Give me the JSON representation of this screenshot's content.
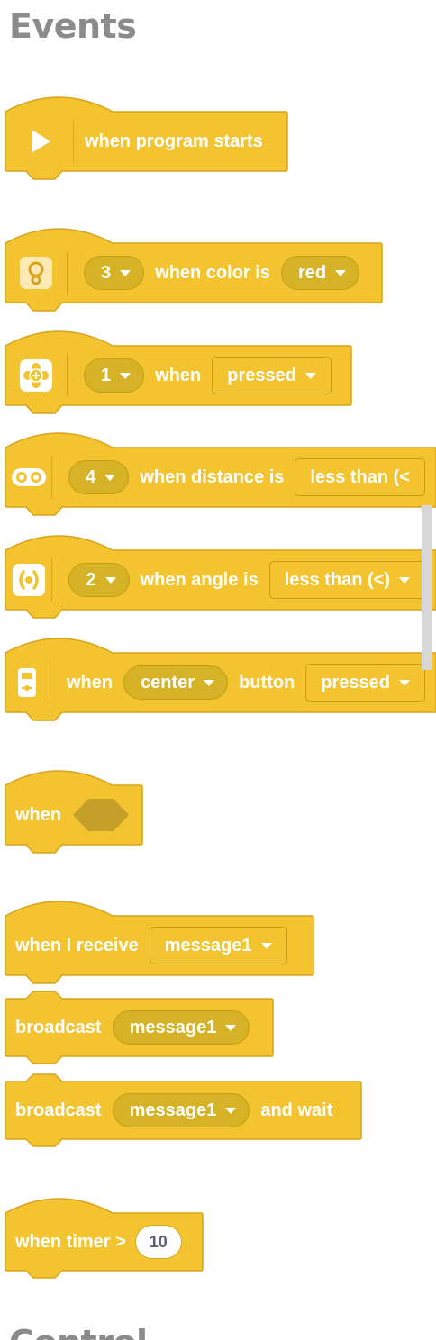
{
  "palette": {
    "category_title": "Events",
    "next_category_title": "Control"
  },
  "blocks": {
    "program_start": {
      "label": "when program starts",
      "icon": "play-icon"
    },
    "color_sensor": {
      "port": "3",
      "label": "when color is",
      "color": "red",
      "icon": "color-sensor-icon"
    },
    "force_sensor": {
      "port": "1",
      "label": "when",
      "state": "pressed",
      "icon": "force-sensor-icon"
    },
    "distance_sensor": {
      "port": "4",
      "label": "when distance is",
      "comparison": "less than (<",
      "icon": "distance-sensor-icon"
    },
    "gyro_sensor": {
      "port": "2",
      "label": "when angle is",
      "comparison": "less than (<)",
      "icon": "gyro-sensor-icon"
    },
    "hub_button": {
      "label_when": "when",
      "button": "center",
      "label_button": "button",
      "state": "pressed",
      "icon": "hub-icon"
    },
    "when_condition": {
      "label": "when"
    },
    "when_receive": {
      "label": "when I receive",
      "message": "message1"
    },
    "broadcast": {
      "label": "broadcast",
      "message": "message1"
    },
    "broadcast_wait": {
      "label": "broadcast",
      "message": "message1",
      "suffix": "and wait"
    },
    "timer": {
      "label": "when timer >",
      "value": "10"
    }
  },
  "colors": {
    "block_fill": "#f3c42f",
    "block_stroke": "#d8a41d",
    "pill_fill": "#d6b227",
    "hexagon_fill": "#c49f2a",
    "title_gray": "#8b8b8b",
    "number_text": "#575e75",
    "scrollbar": "#d7d7d7"
  }
}
